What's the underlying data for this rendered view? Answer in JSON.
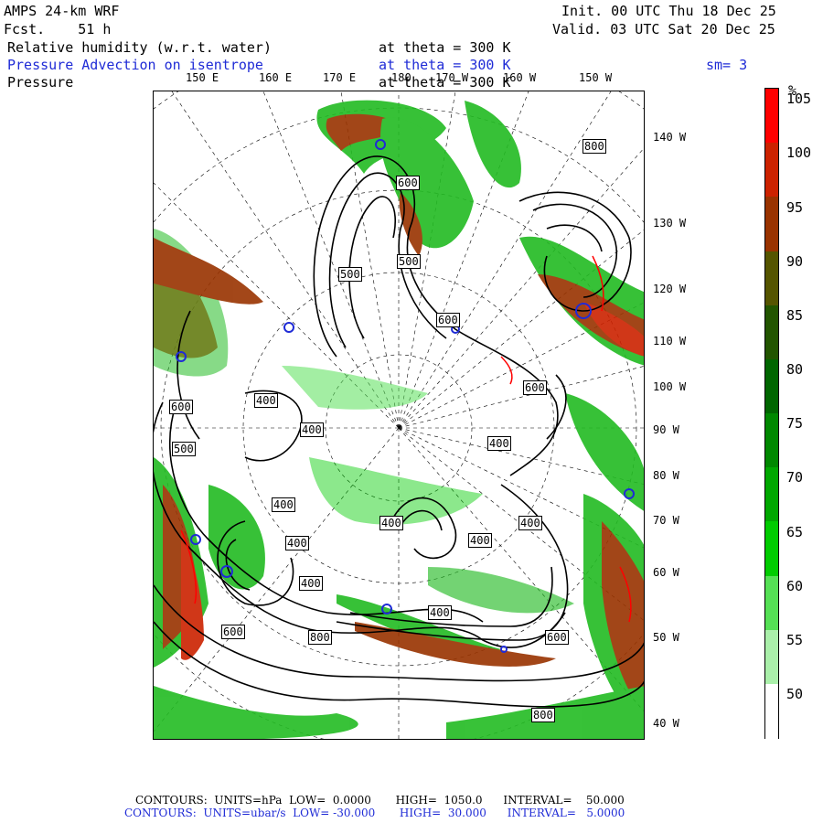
{
  "header": {
    "model": "AMPS 24-km WRF",
    "fcst": "Fcst.    51 h",
    "init": "Init. 00 UTC Thu 18 Dec 25",
    "valid": "Valid. 03 UTC Sat 20 Dec 25",
    "field1_name": "Relative humidity (w.r.t. water)",
    "field1_level": "at theta = 300 K",
    "field2_name": "Pressure Advection on isentrope",
    "field2_level": "at theta = 300 K",
    "smoothing": "sm= 3",
    "field3_name": "Pressure",
    "field3_level": "at theta = 300 K"
  },
  "lon_labels_top": [
    "150 E",
    "160 E",
    "170 E",
    "180",
    "170 W",
    "160 W",
    "150 W"
  ],
  "lon_labels_right": [
    "140 W",
    "130 W",
    "120 W",
    "110 W",
    "100 W",
    "90 W",
    "80 W",
    "70 W",
    "60 W",
    "50 W",
    "40 W"
  ],
  "contour_labels": [
    "800",
    "600",
    "500",
    "500",
    "600",
    "600",
    "600",
    "400",
    "400",
    "400",
    "400",
    "400",
    "400",
    "400",
    "400",
    "400",
    "600",
    "800",
    "600",
    "400",
    "500",
    "800"
  ],
  "colorbar": {
    "unit": "%",
    "labels": [
      "105",
      "100",
      "95",
      "90",
      "85",
      "80",
      "75",
      "70",
      "65",
      "60",
      "55",
      "50"
    ],
    "colors": [
      "#ff0000",
      "#cc2200",
      "#993300",
      "#555500",
      "#225500",
      "#006600",
      "#008800",
      "#00a800",
      "#00cc00",
      "#55e055",
      "#aaf0aa",
      "#ffffff"
    ]
  },
  "footer": {
    "line1": "CONTOURS:  UNITS=hPa  LOW=  0.0000       HIGH=  1050.0      INTERVAL=    50.000",
    "line2": "CONTOURS:  UNITS=ubar/s  LOW= -30.000       HIGH=  30.000      INTERVAL=   5.0000"
  }
}
